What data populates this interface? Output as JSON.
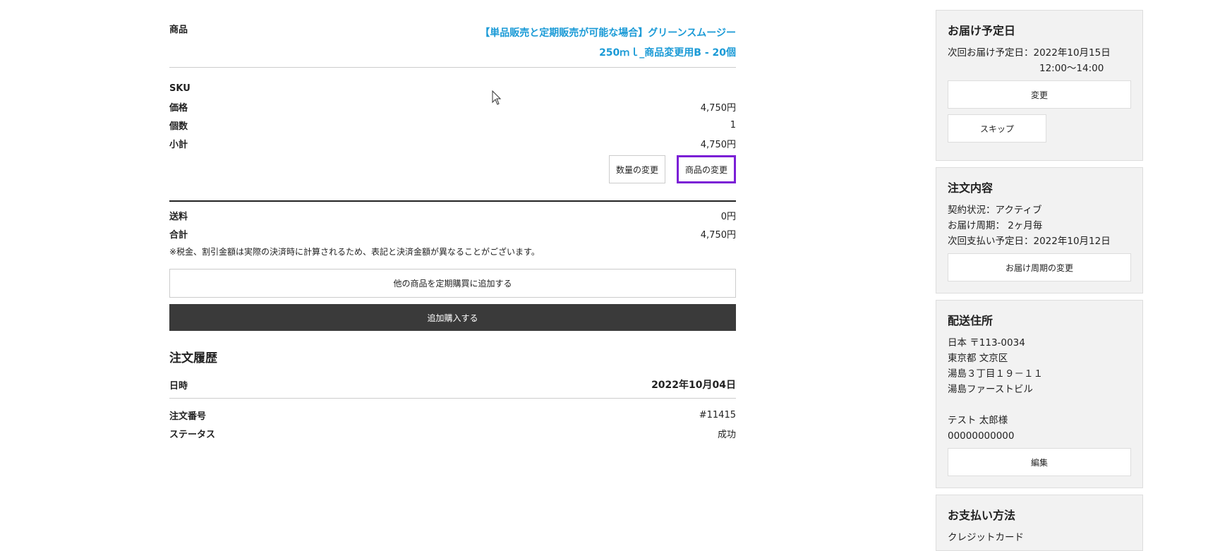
{
  "product": {
    "label": "商品",
    "name_line1": "【単品販売と定期販売が可能な場合】グリーンスムージー",
    "name_line2": "250ｍｌ_商品変更用B - 20個"
  },
  "details": [
    {
      "label": "SKU",
      "value": ""
    },
    {
      "label": "価格",
      "value": "4,750円"
    },
    {
      "label": "個数",
      "value": "1"
    },
    {
      "label": "小計",
      "value": "4,750円"
    }
  ],
  "buttons": {
    "change_quantity": "数量の変更",
    "change_product": "商品の変更",
    "add_other": "他の商品を定期購買に追加する",
    "add_purchase": "追加購入する"
  },
  "totals": [
    {
      "label": "送料",
      "value": "0円"
    },
    {
      "label": "合計",
      "value": "4,750円"
    }
  ],
  "note": "※税金、割引金額は実際の決済時に計算されるため、表記と決済金額が異なることがございます。",
  "history": {
    "title": "注文履歴",
    "date_label": "日時",
    "date_value": "2022年10月04日",
    "order_no_label": "注文番号",
    "order_no_value": "#11415",
    "status_label": "ステータス",
    "status_value": "成功"
  },
  "sidebar": {
    "delivery": {
      "title": "お届け予定日",
      "line1": "次回お届け予定日：2022年10月15日",
      "line2": "12:00～14:00",
      "change_btn": "変更",
      "skip_btn": "スキップ"
    },
    "order": {
      "title": "注文内容",
      "line1": "契約状況：アクティブ",
      "line2": "お届け周期： 2ヶ月毎",
      "line3": "次回支払い予定日：2022年10月12日",
      "cycle_btn": "お届け周期の変更"
    },
    "address": {
      "title": "配送住所",
      "line1": "日本 〒113-0034",
      "line2": "東京都 文京区",
      "line3": "湯島３丁目１９－１１",
      "line4": "湯島ファーストビル",
      "line5": "テスト 太郎様",
      "line6": "00000000000",
      "edit_btn": "編集"
    },
    "payment": {
      "title": "お支払い方法",
      "line1": "クレジットカード"
    }
  }
}
